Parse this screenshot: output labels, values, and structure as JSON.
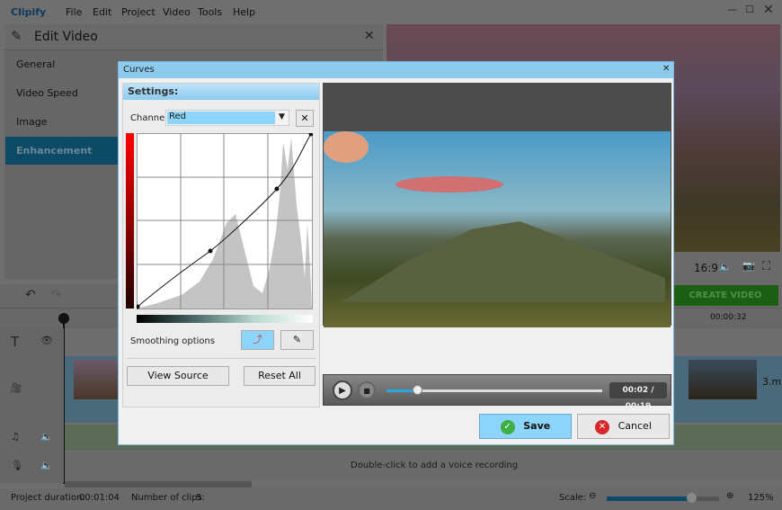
{
  "app": {
    "name": "Clipify",
    "menu": [
      "File",
      "Edit",
      "Project",
      "Video",
      "Tools",
      "Help"
    ]
  },
  "edit_panel": {
    "title": "Edit Video",
    "items": [
      "General",
      "Video Speed",
      "Image",
      "Enhancement"
    ],
    "selected": "Enhancement"
  },
  "preview": {
    "aspect": "16:9",
    "create_video": "CREATE VIDEO"
  },
  "timeline": {
    "ruler_time": "00:00:32",
    "clip_name": "3.mp",
    "voice_hint": "Double-click to add a voice recording"
  },
  "status": {
    "project_duration_label": "Project duration:",
    "project_duration": "00:01:04",
    "clips_label": "Number of clips:",
    "clips": "5",
    "scale_label": "Scale:",
    "scale_value": "125%",
    "scale_level": 0.75
  },
  "dialog": {
    "title": "Curves",
    "settings_label": "Settings:",
    "channel_label": "Channel",
    "channel_value": "Red",
    "smoothing_label": "Smoothing options",
    "view_source": "View Source",
    "reset_all": "Reset All",
    "time": "00:02 / 00:19",
    "progress": 0.14,
    "save": "Save",
    "cancel": "Cancel"
  },
  "colors": {
    "accent": "#8ccbee",
    "create_video": "#2a7a1e",
    "selected_item": "#0d4a66"
  }
}
